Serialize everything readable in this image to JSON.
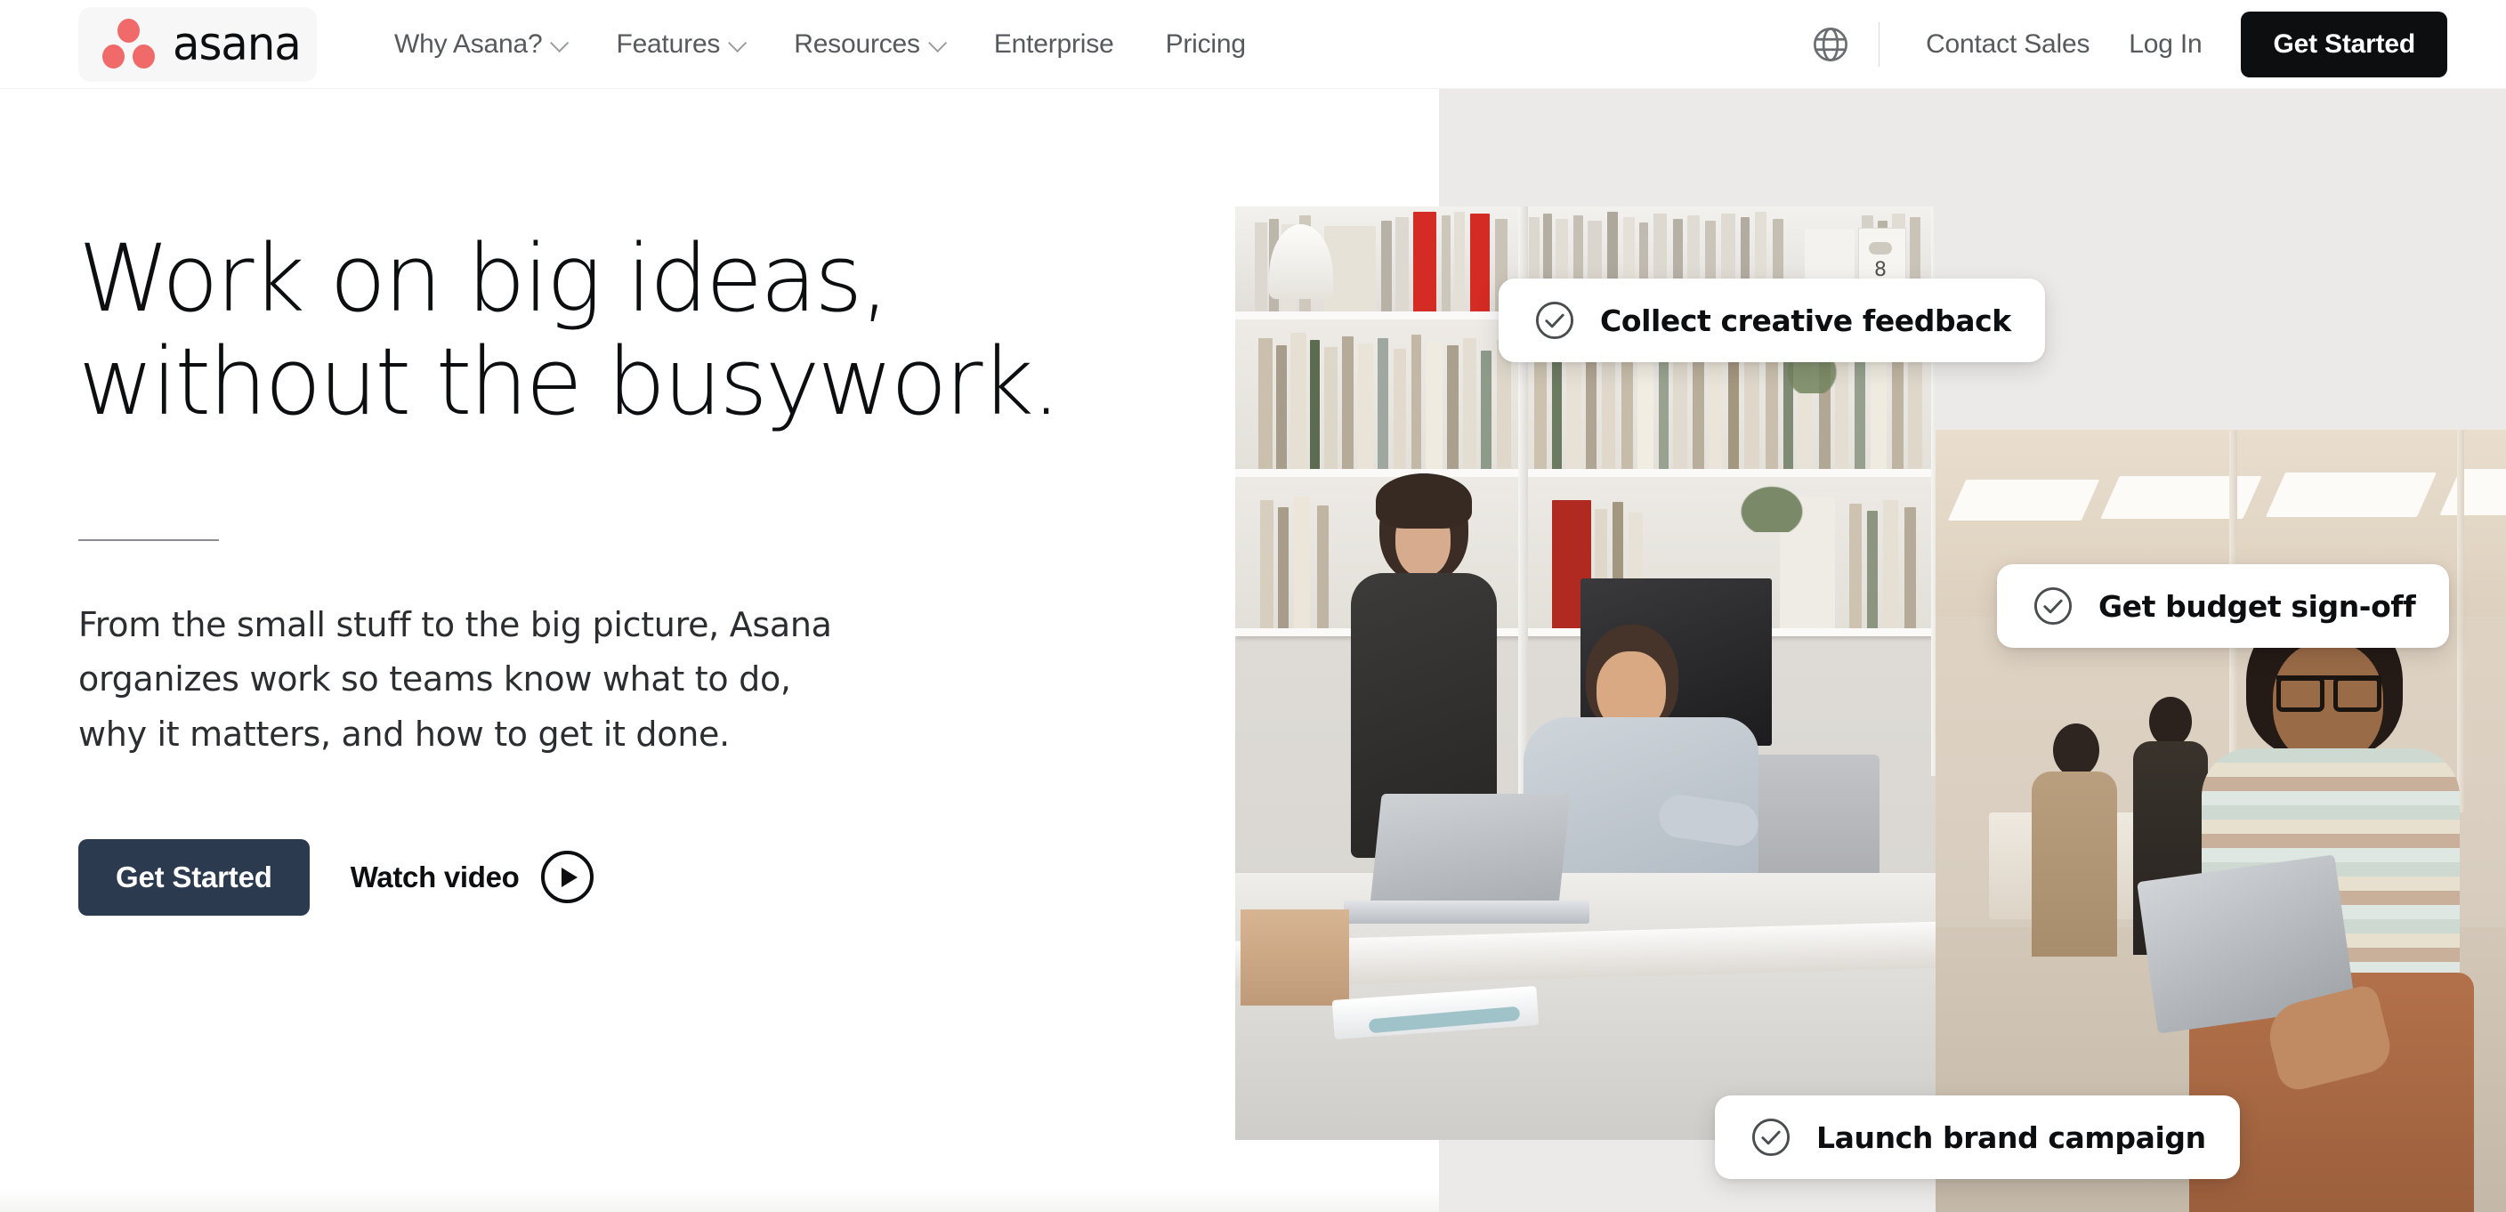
{
  "brand": {
    "logo_text": "asana",
    "logo_icon": "asana-logo-three-dots",
    "logo_color": "#f06a6a"
  },
  "header": {
    "nav_items": [
      {
        "label": "Why Asana?",
        "has_chevron": true
      },
      {
        "label": "Features",
        "has_chevron": true
      },
      {
        "label": "Resources",
        "has_chevron": true
      },
      {
        "label": "Enterprise",
        "has_chevron": false
      },
      {
        "label": "Pricing",
        "has_chevron": false
      }
    ],
    "globe_icon": "globe-icon",
    "contact_sales_label": "Contact Sales",
    "log_in_label": "Log In",
    "get_started_label": "Get Started",
    "get_started_bg": "#0d0e10"
  },
  "hero": {
    "headline": "Work on big ideas,\nwithout the busywork.",
    "subcopy": "From the small stuff to the big picture, Asana\norganizes work so teams know what to do,\nwhy it matters, and how to get it done.",
    "primary_cta_label": "Get Started",
    "primary_cta_bg": "#2b3a4e",
    "secondary_cta_label": "Watch video",
    "secondary_cta_icon": "play-circle-icon"
  },
  "media": {
    "background_panel_color": "#ebeae8",
    "photos": [
      {
        "name": "studio-bookshelf-photo",
        "alt": "Two colleagues working at a desk in a design studio with tall bookshelves"
      },
      {
        "name": "open-office-photo",
        "alt": "Woman with glasses holding a laptop in a bright open office"
      }
    ],
    "pills": [
      {
        "label": "Collect creative feedback",
        "icon": "check-circle-icon"
      },
      {
        "label": "Get budget sign-off",
        "icon": "check-circle-icon"
      },
      {
        "label": "Launch brand campaign",
        "icon": "check-circle-icon"
      }
    ]
  }
}
